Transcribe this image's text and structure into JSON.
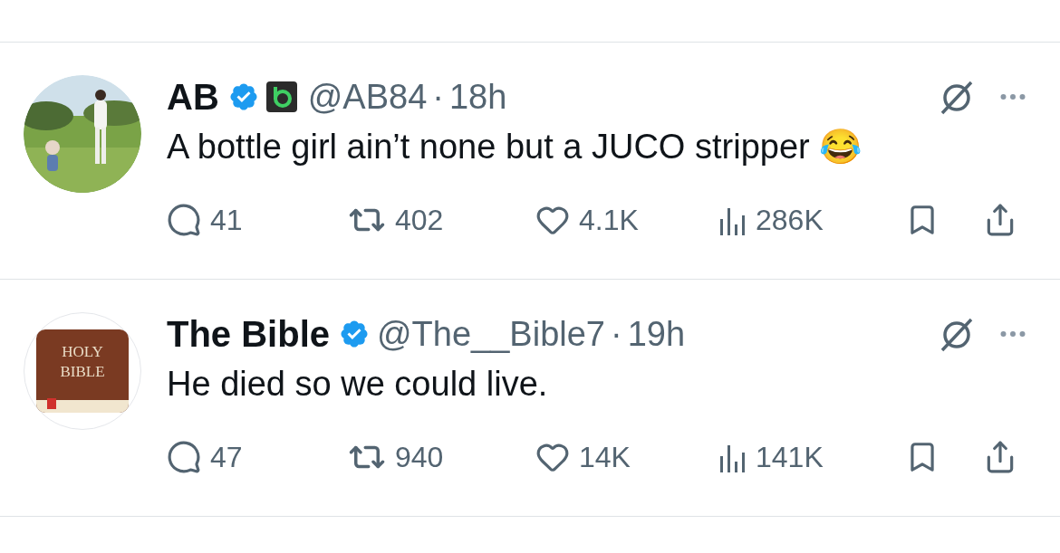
{
  "tweets": [
    {
      "name": "AB",
      "verified": true,
      "affiliate": true,
      "handle": "@AB84",
      "separator": "·",
      "time": "18h",
      "text": "A bottle girl ain’t none but a JUCO stripper 😂",
      "replies": "41",
      "reposts": "402",
      "likes": "4.1K",
      "views": "286K"
    },
    {
      "avatar": {
        "kind": "logo",
        "text": "HOLY BIBLE"
      },
      "name": "The Bible",
      "verified": true,
      "handle": "@The__Bible7",
      "separator": "·",
      "time": "19h",
      "text": "He died so we could live.",
      "replies": "47",
      "reposts": "940",
      "likes": "14K",
      "views": "141K"
    }
  ]
}
